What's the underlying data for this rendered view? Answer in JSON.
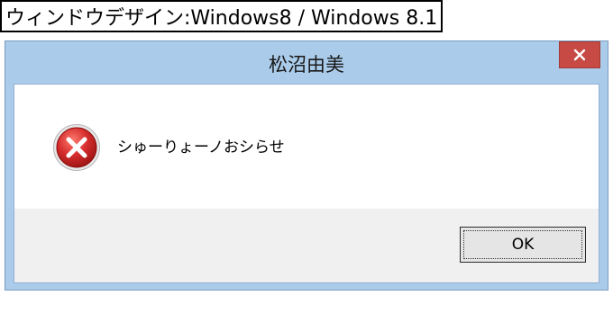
{
  "caption": {
    "text": "ウィンドウデザイン:Windows8 / Windows 8.1"
  },
  "dialog": {
    "title": "松沼由美",
    "close_icon": "close-icon",
    "message": "シゅーりょーノおシらせ",
    "status_icon": "error-icon",
    "ok_label": "OK"
  },
  "colors": {
    "frame": "#aacbea",
    "close_button": "#c74a45",
    "footer": "#f0f0f0",
    "error_red": "#d42c2c"
  }
}
